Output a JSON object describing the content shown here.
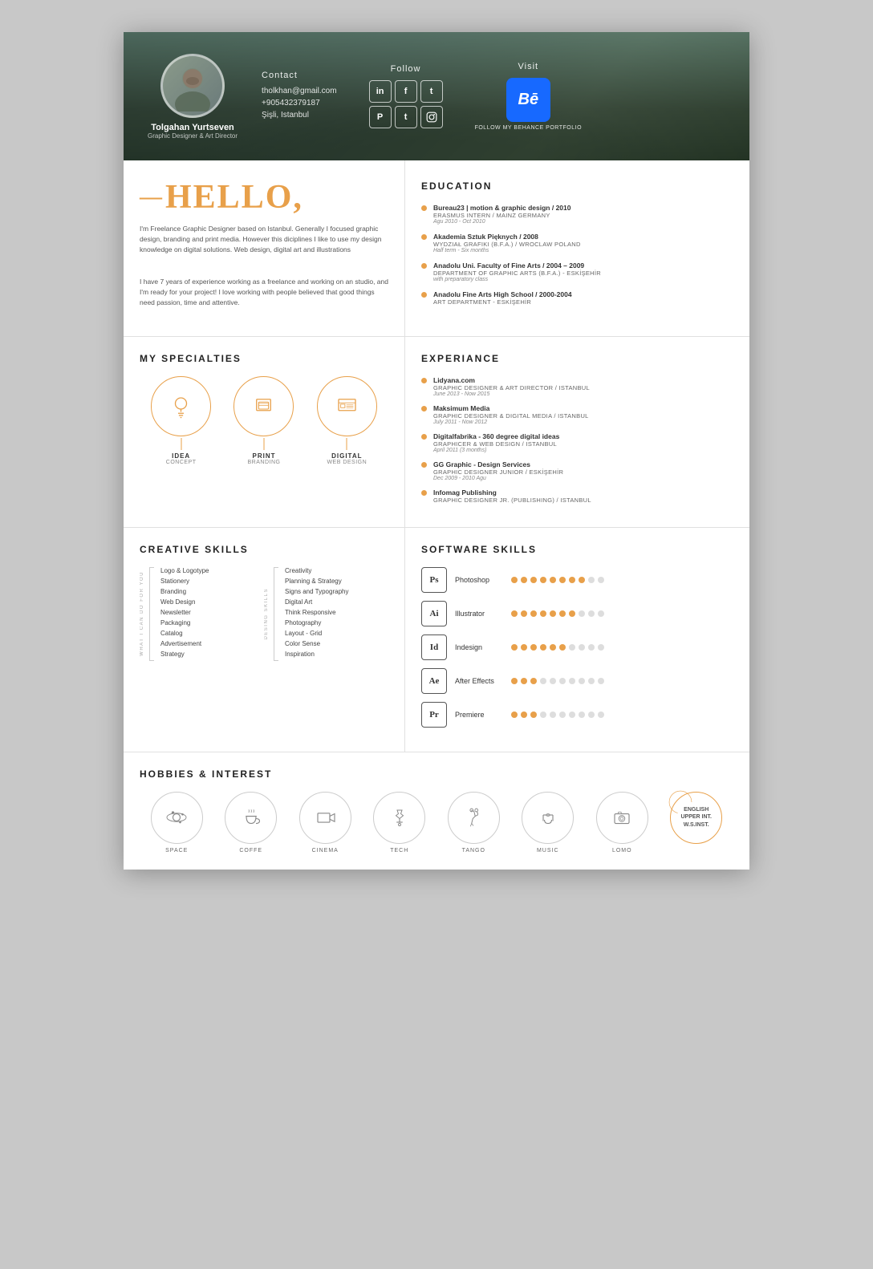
{
  "header": {
    "name": "Tolgahan Yurtseven",
    "title": "Graphic Designer & Art Director",
    "contact": {
      "label": "Contact",
      "email": "tholkhan@gmail.com",
      "phone": "+905432379187",
      "location": "Şişli, Istanbul"
    },
    "follow": {
      "label": "Follow",
      "networks": [
        "in",
        "f",
        "t",
        "P",
        "t",
        "📷"
      ]
    },
    "visit": {
      "label": "Visit",
      "cta": "FOLLOW MY BEHANCE PORTFOLIO"
    }
  },
  "hello": {
    "title": "HELLO,",
    "dash": "—",
    "para1": "I'm Freelance Graphic Designer based on Istanbul. Generally I focused graphic design, branding and print media. However this diciplines I like to use my design knowledge on digital solutions. Web design, digital art and illustrations",
    "para2": "I have 7 years of experience working as a freelance and working on an studio, and I'm ready for your project! I love working with people believed that good things need passion, time and attentive."
  },
  "education": {
    "title": "EDUCATION",
    "items": [
      {
        "main": "Bureau23 | motion & graphic design / 2010",
        "sub": "ERASMUS INTERN / MAINZ GERMANY",
        "date": "Agu 2010 - Oct 2010"
      },
      {
        "main": "Akademia Sztuk Pięknych / 2008",
        "sub": "WYDZIAŁ GRAFIKI (B.F.A.) / WROCLAW POLAND",
        "date": "Half term - Six months"
      },
      {
        "main": "Anadolu Uni. Faculty of Fine Arts / 2004 – 2009",
        "sub": "DEPARTMENT OF GRAPHIC ARTS (B.F.A.) - ESKİŞEHİR",
        "date": "with preparatory class"
      },
      {
        "main": "Anadolu Fine Arts High School / 2000-2004",
        "sub": "ART DEPARTMENT - ESKİŞEHİR",
        "date": ""
      }
    ]
  },
  "specialties": {
    "title": "MY SPECIALTIES",
    "items": [
      {
        "label": "IDEA",
        "sublabel": "CONCEPT"
      },
      {
        "label": "PRINT",
        "sublabel": "BRANDING"
      },
      {
        "label": "DIGITAL",
        "sublabel": "WEB DESIGN"
      }
    ]
  },
  "experience": {
    "title": "EXPERIANCE",
    "items": [
      {
        "main": "Lidyana.com",
        "sub": "GRAPHIC DESIGNER & ART DIRECTOR / ISTANBUL",
        "date": "June 2013 - Now 2015"
      },
      {
        "main": "Maksimum Media",
        "sub": "GRAPHIC DESIGNER & DIGITAL MEDIA / ISTANBUL",
        "date": "July 2011 - Now 2012"
      },
      {
        "main": "Digitalfabrika - 360 degree digital ideas",
        "sub": "GRAPHICER & WEB DESIGN / ISTANBUL",
        "date": "April 2011 (3 months)"
      },
      {
        "main": "GG Graphic - Design Services",
        "sub": "GRAPHIC DESIGNER JUNIOR / ESKİŞEHİR",
        "date": "Dec 2009 - 2010 Agu"
      },
      {
        "main": "Infomag Publishing",
        "sub": "GRAPHIC DESIGNER JR. (PUBLISHING) / ISTANBUL",
        "date": ""
      }
    ]
  },
  "creativeSkills": {
    "title": "CREATIVE SKILLS",
    "whatICan": "WHAT I CAN DO FOR YOU",
    "desingSkills": "DESING SKILLS",
    "left": [
      "Logo & Logotype",
      "Stationery",
      "Branding",
      "Web Design",
      "Newsletter",
      "Packaging",
      "Catalog",
      "Advertisement",
      "Strategy"
    ],
    "right": [
      "Creativity",
      "Planning & Strategy",
      "Signs and Typography",
      "Digital Art",
      "Think Responsive",
      "Photography",
      "Layout - Grid",
      "Color Sense",
      "Inspiration"
    ]
  },
  "softwareSkills": {
    "title": "SOFTWARE SKILLS",
    "items": [
      {
        "label": "Ps",
        "name": "Photoshop",
        "filled": 8,
        "empty": 2
      },
      {
        "label": "Ai",
        "name": "Illustrator",
        "filled": 7,
        "empty": 3
      },
      {
        "label": "Id",
        "name": "Indesign",
        "filled": 6,
        "empty": 4
      },
      {
        "label": "Ae",
        "name": "After Effects",
        "filled": 3,
        "empty": 7
      },
      {
        "label": "Pr",
        "name": "Premiere",
        "filled": 3,
        "empty": 7
      }
    ]
  },
  "hobbies": {
    "title": "HOBBIES & INTEREST",
    "items": [
      {
        "label": "SPACE",
        "icon": "space"
      },
      {
        "label": "COFFE",
        "icon": "coffee"
      },
      {
        "label": "CINEMA",
        "icon": "cinema"
      },
      {
        "label": "TECH",
        "icon": "tech"
      },
      {
        "label": "TANGO",
        "icon": "tango"
      },
      {
        "label": "MUSIC",
        "icon": "music"
      },
      {
        "label": "LOMO",
        "icon": "lomo"
      },
      {
        "label": "ENGLISH\nUPPER INT.\nW.S.INST.",
        "icon": "english"
      }
    ]
  }
}
